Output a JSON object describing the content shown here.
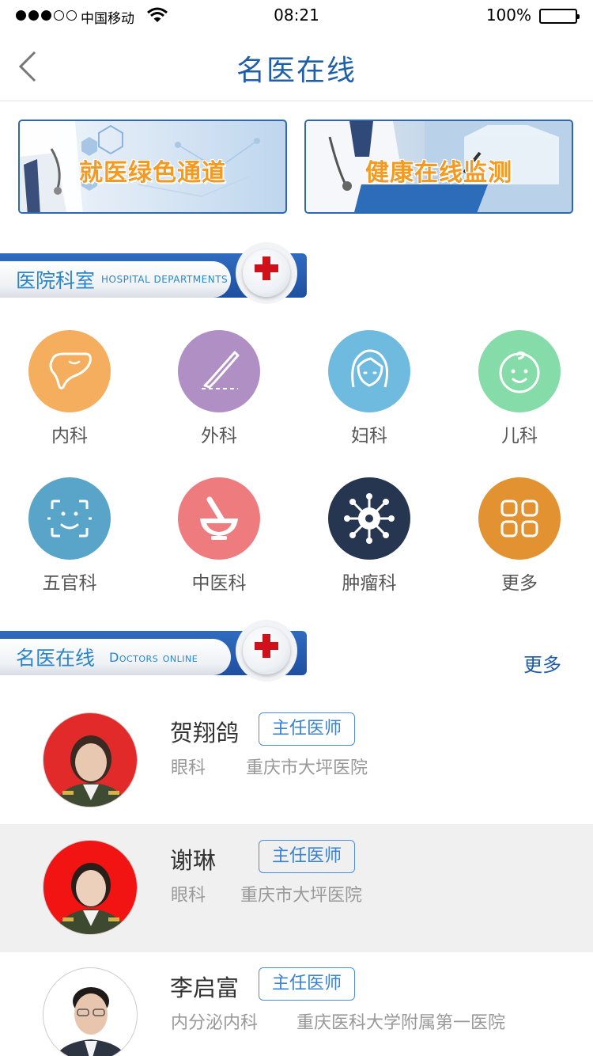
{
  "status_bar": {
    "carrier": "中国移动",
    "time": "08:21",
    "battery": "100%"
  },
  "nav": {
    "title": "名医在线"
  },
  "banners": [
    {
      "label": "就医绿色通道"
    },
    {
      "label": "健康在线监测"
    }
  ],
  "departments_section": {
    "title_zh": "医院科室",
    "title_en": "HOSPITAL DEPARTMENTS",
    "items": [
      {
        "label": "内科",
        "icon": "liver-icon",
        "color": "#f4ae5e"
      },
      {
        "label": "外科",
        "icon": "scalpel-icon",
        "color": "#b08fc4"
      },
      {
        "label": "妇科",
        "icon": "woman-face-icon",
        "color": "#6fbadf"
      },
      {
        "label": "儿科",
        "icon": "baby-face-icon",
        "color": "#85dca9"
      },
      {
        "label": "五官科",
        "icon": "face-scan-icon",
        "color": "#58a5c9"
      },
      {
        "label": "中医科",
        "icon": "mortar-pestle-icon",
        "color": "#ee7c7f"
      },
      {
        "label": "肿瘤科",
        "icon": "virus-icon",
        "color": "#263651"
      },
      {
        "label": "更多",
        "icon": "grid-icon",
        "color": "#e39231"
      }
    ]
  },
  "doctors_section": {
    "title_zh": "名医在线",
    "title_en": "Doctors online",
    "more": "更多",
    "doctors": [
      {
        "name": "贺翔鸽",
        "title": "主任医师",
        "department": "眼科",
        "hospital": "重庆市大坪医院"
      },
      {
        "name": "谢琳",
        "title": "主任医师",
        "department": "眼科",
        "hospital": "重庆市大坪医院"
      },
      {
        "name": "李启富",
        "title": "主任医师",
        "department": "内分泌内科",
        "hospital": "重庆医科大学附属第一医院"
      }
    ]
  }
}
